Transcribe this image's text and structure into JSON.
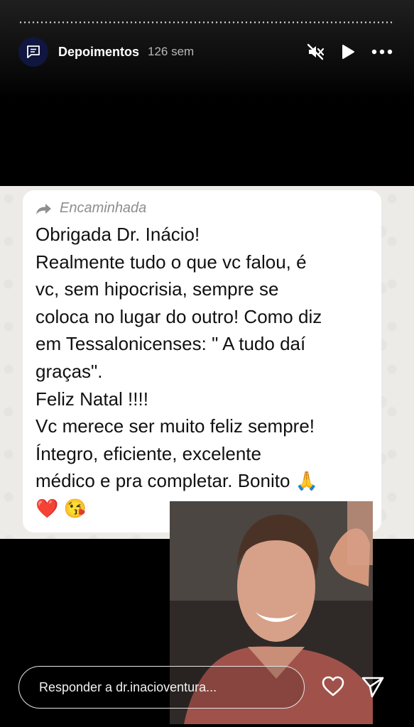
{
  "story": {
    "account_name": "Depoimentos",
    "time_ago": "126 sem",
    "icons": {
      "avatar": "message-lines-icon",
      "mute": "speaker-muted-icon",
      "play": "play-icon",
      "more": "more-dots-icon",
      "like": "heart-icon",
      "share": "send-arrow-icon"
    }
  },
  "message": {
    "forwarded_label": "Encaminhada",
    "lines": [
      "Obrigada Dr. Inácio!",
      "Realmente tudo o que vc falou, é",
      "vc, sem hipocrisia, sempre se",
      "coloca no lugar do outro! Como diz",
      "em Tessalonicenses: \" A tudo daí",
      "graças\".",
      "Feliz Natal !!!!",
      "Vc merece ser muito feliz sempre!",
      "Íntegro, eficiente, excelente",
      "médico e pra completar. Bonito 🙏",
      "❤️ 😘"
    ]
  },
  "reply": {
    "placeholder": "Responder a dr.inacioventura..."
  }
}
